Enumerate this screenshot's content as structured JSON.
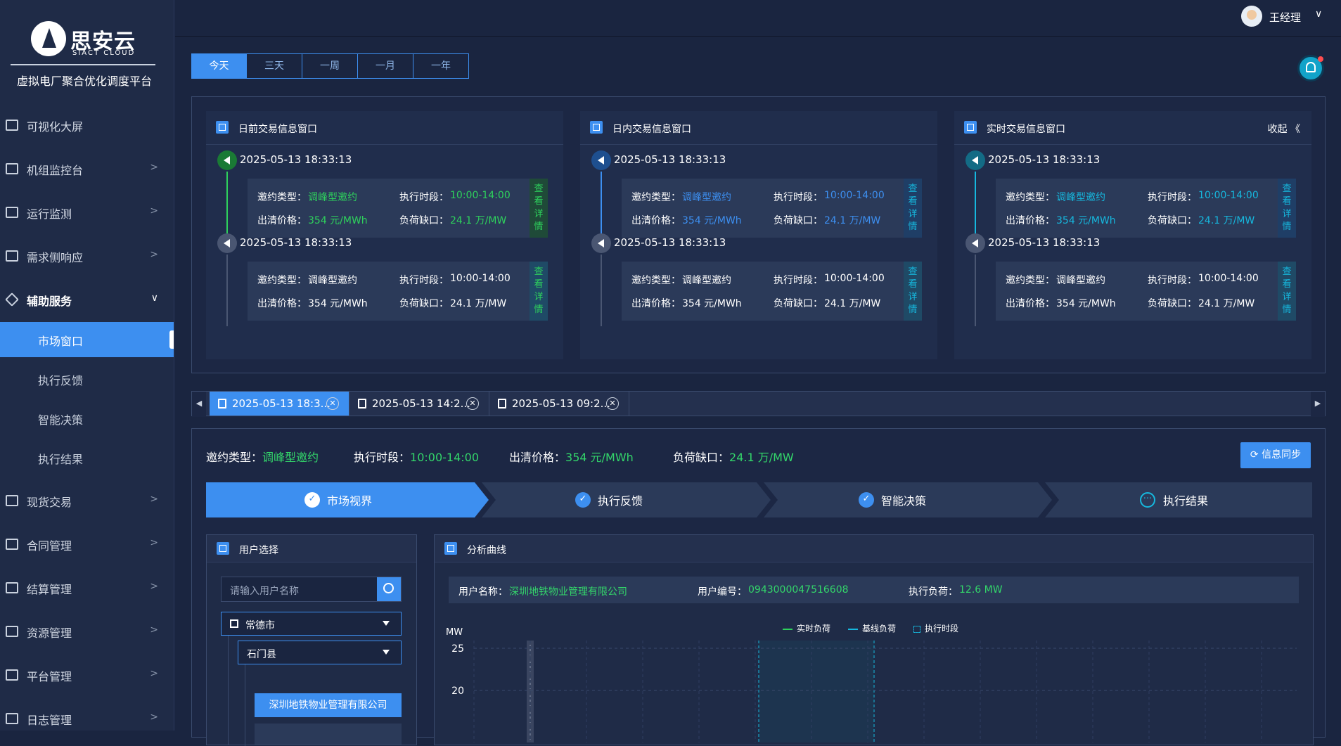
{
  "brand": {
    "name_cn": "思安云",
    "name_en": "SIACT CLOUD",
    "platform": "虚拟电厂聚合优化调度平台"
  },
  "sidebar": {
    "items": [
      {
        "label": "可视化大屏",
        "chevron": ""
      },
      {
        "label": "机组监控台",
        "chevron": ">"
      },
      {
        "label": "运行监测",
        "chevron": ">"
      },
      {
        "label": "需求侧响应",
        "chevron": ">"
      },
      {
        "label": "辅助服务",
        "chevron": "∨"
      },
      {
        "label": "现货交易",
        "chevron": ">"
      },
      {
        "label": "合同管理",
        "chevron": ">"
      },
      {
        "label": "结算管理",
        "chevron": ">"
      },
      {
        "label": "资源管理",
        "chevron": ">"
      },
      {
        "label": "平台管理",
        "chevron": ">"
      },
      {
        "label": "日志管理",
        "chevron": ">"
      }
    ],
    "subitems": [
      {
        "label": "市场窗口",
        "active": true
      },
      {
        "label": "执行反馈",
        "active": false
      },
      {
        "label": "智能决策",
        "active": false
      },
      {
        "label": "执行结果",
        "active": false
      }
    ]
  },
  "header": {
    "username": "王经理",
    "dropdown": "∨"
  },
  "date_tabs": [
    "今天",
    "三天",
    "一周",
    "一月",
    "一年"
  ],
  "trade_windows": [
    {
      "title": "日前交易信息窗口",
      "accent": "#2ed15c",
      "entries": [
        {
          "time": "2025-05-13 18:33:13",
          "type_label": "邀约类型：",
          "type": "调峰型邀约",
          "period_label": "执行时段：",
          "period": "10:00-14:00",
          "price_label": "出清价格：",
          "price": "354 元/MWh",
          "gap_label": "负荷缺口：",
          "gap": "24.1 万/MW",
          "detail": "查看详情",
          "active": true
        },
        {
          "time": "2025-05-13 18:33:13",
          "type_label": "邀约类型：",
          "type": "调峰型邀约",
          "period_label": "执行时段：",
          "period": "10:00-14:00",
          "price_label": "出清价格：",
          "price": "354 元/MWh",
          "gap_label": "负荷缺口：",
          "gap": "24.1 万/MW",
          "detail": "查看详情",
          "active": false
        }
      ]
    },
    {
      "title": "日内交易信息窗口",
      "accent": "#3d8ff0",
      "entries": [
        {
          "time": "2025-05-13 18:33:13",
          "type_label": "邀约类型：",
          "type": "调峰型邀约",
          "period_label": "执行时段：",
          "period": "10:00-14:00",
          "price_label": "出清价格：",
          "price": "354 元/MWh",
          "gap_label": "负荷缺口：",
          "gap": "24.1 万/MW",
          "detail": "查看详情",
          "active": true
        },
        {
          "time": "2025-05-13 18:33:13",
          "type_label": "邀约类型：",
          "type": "调峰型邀约",
          "period_label": "执行时段：",
          "period": "10:00-14:00",
          "price_label": "出清价格：",
          "price": "354 元/MWh",
          "gap_label": "负荷缺口：",
          "gap": "24.1 万/MW",
          "detail": "查看详情",
          "active": false
        }
      ]
    },
    {
      "title": "实时交易信息窗口",
      "accent": "#16b8de",
      "collapse": "收起 《",
      "entries": [
        {
          "time": "2025-05-13 18:33:13",
          "type_label": "邀约类型：",
          "type": "调峰型邀约",
          "period_label": "执行时段：",
          "period": "10:00-14:00",
          "price_label": "出清价格：",
          "price": "354 元/MWh",
          "gap_label": "负荷缺口：",
          "gap": "24.1 万/MW",
          "detail": "查看详情",
          "active": true
        },
        {
          "time": "2025-05-13 18:33:13",
          "type_label": "邀约类型：",
          "type": "调峰型邀约",
          "period_label": "执行时段：",
          "period": "10:00-14:00",
          "price_label": "出清价格：",
          "price": "354 元/MWh",
          "gap_label": "负荷缺口：",
          "gap": "24.1 万/MW",
          "detail": "查看详情",
          "active": false
        }
      ]
    }
  ],
  "record_tabs": [
    "2025-05-13 18:3...",
    "2025-05-13 14:2...",
    "2025-05-13 09:2..."
  ],
  "summary": {
    "type_label": "邀约类型：",
    "type": "调峰型邀约",
    "period_label": "执行时段：",
    "period": "10:00-14:00",
    "price_label": "出清价格：",
    "price": "354  元/MWh",
    "gap_label": "负荷缺口：",
    "gap": "24.1  万/MW",
    "sync_label": "信息同步"
  },
  "steps": [
    {
      "label": "市场视界",
      "state": "done"
    },
    {
      "label": "执行反馈",
      "state": "done"
    },
    {
      "label": "智能决策",
      "state": "done"
    },
    {
      "label": "执行结果",
      "state": "pending"
    }
  ],
  "user_panel": {
    "title": "用户选择",
    "search_placeholder": "请输入用户名称",
    "city": "常德市",
    "county": "石门县",
    "company": "深圳地铁物业管理有限公司"
  },
  "analysis": {
    "title": "分析曲线",
    "user_name_label": "用户名称：",
    "user_name": "深圳地铁物业管理有限公司",
    "user_id_label": "用户编号：",
    "user_id": "0943000047516608",
    "load_label": "执行负荷：",
    "load": "12.6 MW"
  },
  "chart_data": {
    "type": "line",
    "ylabel": "MW",
    "yticks": [
      25,
      20
    ],
    "series": [
      {
        "name": "实时负荷",
        "values": []
      },
      {
        "name": "基线负荷",
        "values": []
      }
    ],
    "legend": [
      "实时负荷",
      "基线负荷",
      "执行时段"
    ],
    "grid": true,
    "colors": {
      "realtime": "#2ed15c",
      "baseline": "#16b8de",
      "period": "#16b8de"
    }
  }
}
